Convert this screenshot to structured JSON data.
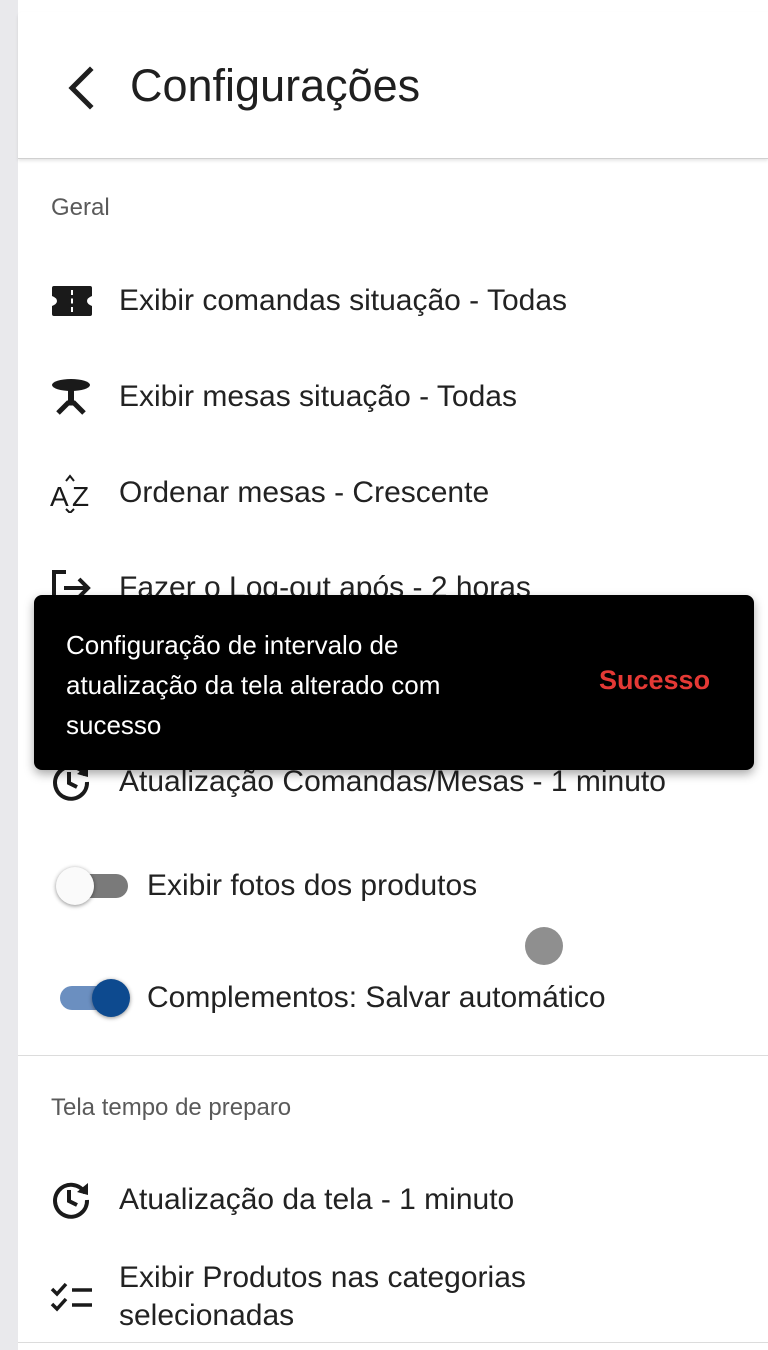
{
  "header": {
    "title": "Configurações"
  },
  "sections": {
    "general": {
      "title": "Geral",
      "items": [
        {
          "icon": "ticket-icon",
          "label": "Exibir comandas situação - Todas"
        },
        {
          "icon": "table-icon",
          "label": "Exibir mesas situação - Todas"
        },
        {
          "icon": "sort-alpha-icon",
          "label": "Ordenar mesas - Crescente"
        },
        {
          "icon": "logout-icon",
          "label": "Fazer o Log-out após - 2 horas"
        },
        {
          "icon": "refresh-clock-icon",
          "label": "Atualização Comandas/Mesas - 1 minuto"
        }
      ],
      "toggles": [
        {
          "label": "Exibir fotos dos produtos",
          "checked": false
        },
        {
          "label": "Complementos: Salvar automático",
          "checked": true
        }
      ]
    },
    "prep": {
      "title": "Tela tempo de preparo",
      "items": [
        {
          "icon": "refresh-clock-icon",
          "label": "Atualização da tela - 1 minuto"
        },
        {
          "icon": "checklist-icon",
          "label": "Exibir Produtos nas categorias selecionadas"
        }
      ]
    }
  },
  "snackbar": {
    "message": "Configuração de intervalo de atualização da tela alterado com sucesso",
    "action": "Sucesso"
  },
  "colors": {
    "accent": "#0d4a8f",
    "toggle_track_on": "#6b8fc0",
    "snackbar_action": "#e53935",
    "snackbar_bg": "#000000"
  }
}
